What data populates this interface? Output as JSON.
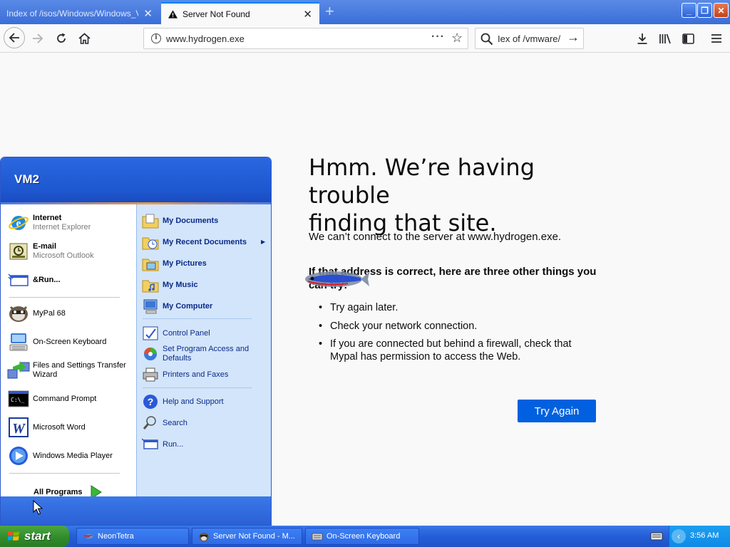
{
  "browser": {
    "tabs": [
      {
        "title": "Index of /isos/Windows/Windows_Vist",
        "active": false
      },
      {
        "title": "Server Not Found",
        "active": true
      }
    ],
    "url": "www.hydrogen.exe",
    "search_text": "Iex of /vmware/"
  },
  "error_page": {
    "title_line1": "Hmm. We’re having trouble",
    "title_line2": "finding that site.",
    "description": "We can’t connect to the server at www.hydrogen.exe.",
    "subtitle": "If that address is correct, here are three other things you can try:",
    "suggestions": [
      "Try again later.",
      "Check your network connection.",
      "If you are connected but behind a firewall, check that Mypal has permission to access the Web."
    ],
    "try_again_label": "Try Again"
  },
  "start_menu": {
    "user": "VM2",
    "pinned": [
      {
        "label": "Internet",
        "sub": "Internet Explorer",
        "icon": "internet-explorer-icon"
      },
      {
        "label": "E-mail",
        "sub": "Microsoft Outlook",
        "icon": "outlook-icon"
      },
      {
        "label": "&Run...",
        "icon": "run-icon"
      }
    ],
    "recent": [
      {
        "label": "MyPal 68",
        "icon": "mypal-icon"
      },
      {
        "label": "On-Screen Keyboard",
        "icon": "keyboard-icon"
      },
      {
        "label": "Files and Settings Transfer Wizard",
        "icon": "transfer-wizard-icon"
      },
      {
        "label": "Command Prompt",
        "icon": "command-prompt-icon"
      },
      {
        "label": "Microsoft Word",
        "icon": "word-icon"
      },
      {
        "label": "Windows Media Player",
        "icon": "media-player-icon"
      }
    ],
    "all_programs": "All Programs",
    "places": [
      {
        "label": "My Documents",
        "icon": "my-documents-icon"
      },
      {
        "label": "My Recent Documents",
        "icon": "recent-documents-icon"
      },
      {
        "label": "My Pictures",
        "icon": "my-pictures-icon"
      },
      {
        "label": "My Music",
        "icon": "my-music-icon"
      },
      {
        "label": "My Computer",
        "icon": "my-computer-icon"
      }
    ],
    "settings": [
      {
        "label": "Control Panel",
        "icon": "control-panel-icon"
      },
      {
        "label": "Set Program Access and Defaults",
        "icon": "program-access-icon"
      },
      {
        "label": "Printers and Faxes",
        "icon": "printer-icon"
      }
    ],
    "help": [
      {
        "label": "Help and Support",
        "icon": "help-icon"
      },
      {
        "label": "Search",
        "icon": "search-icon"
      },
      {
        "label": "Run...",
        "icon": "run-icon"
      }
    ]
  },
  "taskbar": {
    "start_label": "start",
    "tasks": [
      {
        "label": "NeonTetra",
        "icon": "neontetra-icon"
      },
      {
        "label": "Server Not Found - M...",
        "icon": "mypal-icon"
      },
      {
        "label": "On-Screen Keyboard",
        "icon": "keyboard-icon"
      }
    ],
    "clock": "3:56 AM"
  },
  "colors": {
    "accent": "#0060df",
    "xp_blue": "#245ed8",
    "start_green": "#2f8a2a",
    "start_menu_right": "#d3e5fa"
  }
}
